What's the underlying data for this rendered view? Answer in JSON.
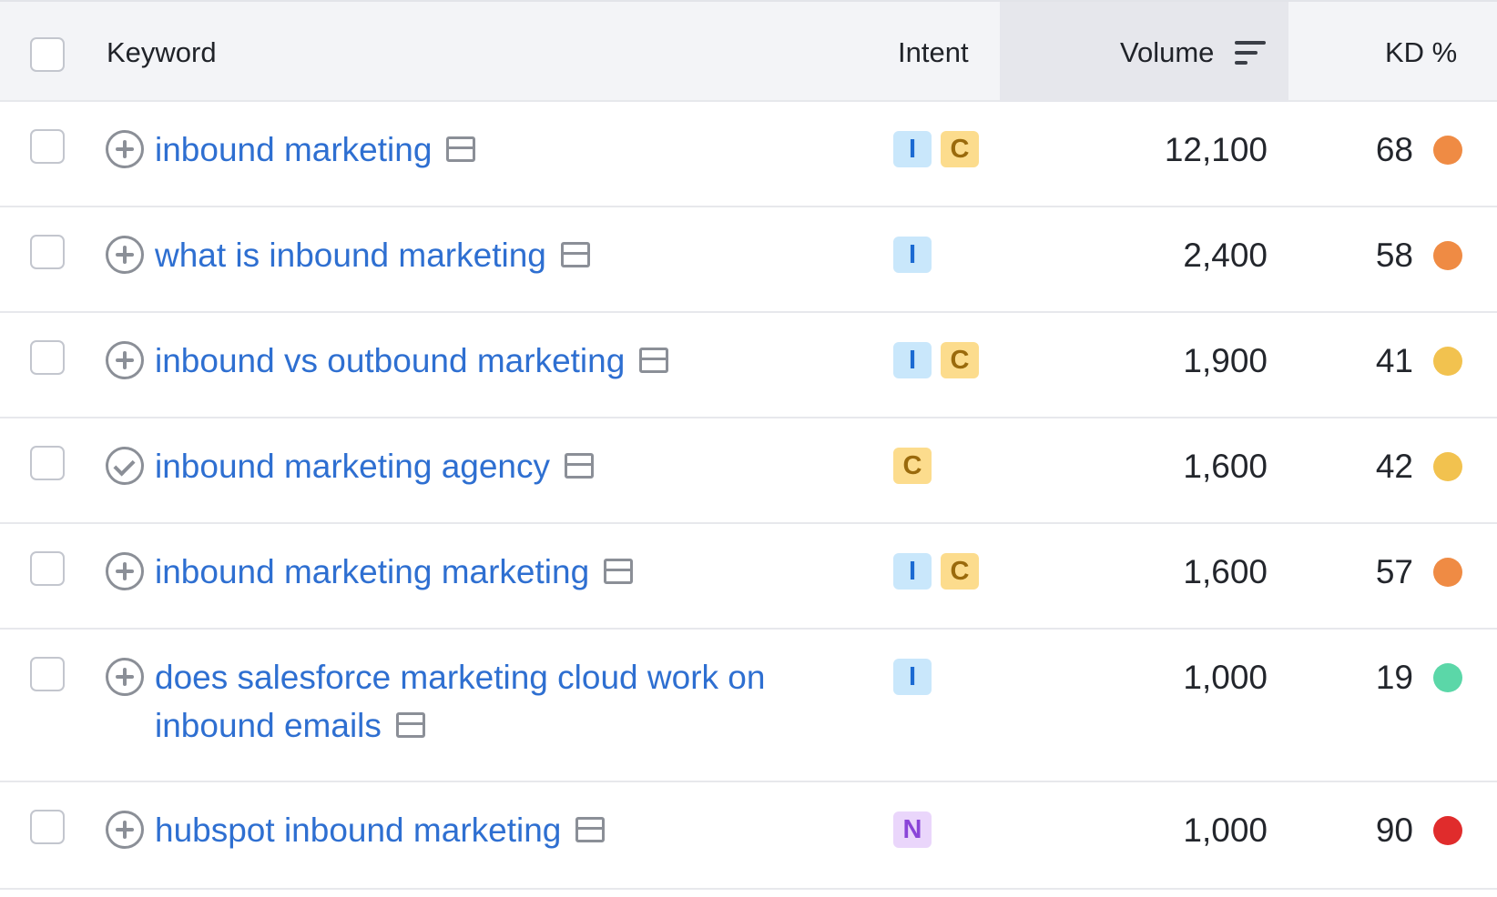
{
  "header": {
    "keyword": "Keyword",
    "intent": "Intent",
    "volume": "Volume",
    "kd": "KD %"
  },
  "rows": [
    {
      "keyword_lines": [
        "inbound marketing"
      ],
      "status_icon": "add-circle-icon",
      "intents": [
        "I",
        "C"
      ],
      "volume": "12,100",
      "kd": "68",
      "kd_color": "#ef8b44"
    },
    {
      "keyword_lines": [
        "what is inbound marketing"
      ],
      "status_icon": "add-circle-icon",
      "intents": [
        "I"
      ],
      "volume": "2,400",
      "kd": "58",
      "kd_color": "#ef8b44"
    },
    {
      "keyword_lines": [
        "inbound vs outbound marketing"
      ],
      "status_icon": "add-circle-icon",
      "intents": [
        "I",
        "C"
      ],
      "volume": "1,900",
      "kd": "41",
      "kd_color": "#f2c24f"
    },
    {
      "keyword_lines": [
        "inbound marketing agency"
      ],
      "status_icon": "checked-circle-icon",
      "intents": [
        "C"
      ],
      "volume": "1,600",
      "kd": "42",
      "kd_color": "#f2c24f"
    },
    {
      "keyword_lines": [
        "inbound marketing marketing"
      ],
      "status_icon": "add-circle-icon",
      "intents": [
        "I",
        "C"
      ],
      "volume": "1,600",
      "kd": "57",
      "kd_color": "#ef8b44"
    },
    {
      "keyword_lines": [
        "does salesforce marketing cloud work on",
        "inbound emails"
      ],
      "status_icon": "add-circle-icon",
      "intents": [
        "I"
      ],
      "volume": "1,000",
      "kd": "19",
      "kd_color": "#5bd7a8"
    },
    {
      "keyword_lines": [
        "hubspot inbound marketing"
      ],
      "status_icon": "add-circle-icon",
      "intents": [
        "N"
      ],
      "volume": "1,000",
      "kd": "90",
      "kd_color": "#e02c2c"
    }
  ]
}
